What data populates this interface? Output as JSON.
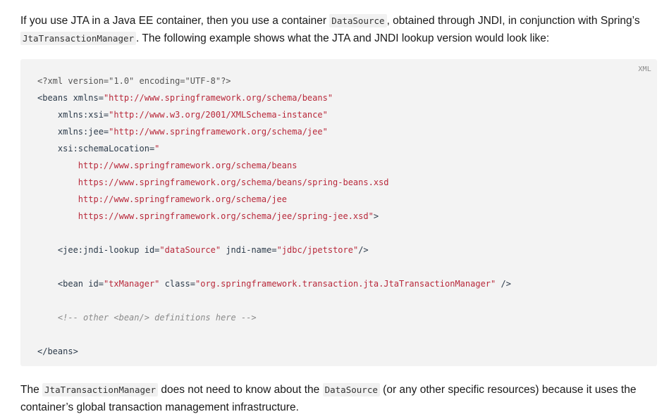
{
  "intro": {
    "t1": "If you use JTA in a Java EE container, then you use a container ",
    "c1": "DataSource",
    "t2": ", obtained through JNDI, in conjunction with Spring’s ",
    "c2": "JtaTransactionManager",
    "t3": ". The following example shows what the JTA and JNDI lookup version would look like:"
  },
  "code": {
    "language": "XML",
    "lines": {
      "l1_pi": "<?xml version=\"1.0\" encoding=\"UTF-8\"?>",
      "l2_tag": "<beans",
      "l2_attr": " xmlns=",
      "l2_val": "\"http://www.springframework.org/schema/beans\"",
      "l3_attr": "    xmlns:xsi=",
      "l3_val": "\"http://www.w3.org/2001/XMLSchema-instance\"",
      "l4_attr": "    xmlns:jee=",
      "l4_val": "\"http://www.springframework.org/schema/jee\"",
      "l5_attr": "    xsi:schemaLocation=",
      "l5_val": "\"",
      "l6_val": "        http://www.springframework.org/schema/beans",
      "l7_val": "        https://www.springframework.org/schema/beans/spring-beans.xsd",
      "l8_val": "        http://www.springframework.org/schema/jee",
      "l9_val": "        https://www.springframework.org/schema/jee/spring-jee.xsd\"",
      "l9_tag": ">",
      "l11_tag": "    <jee:jndi-lookup",
      "l11_attr1": " id=",
      "l11_val1": "\"dataSource\"",
      "l11_attr2": " jndi-name=",
      "l11_val2": "\"jdbc/jpetstore\"",
      "l11_end": "/>",
      "l13_tag": "    <bean",
      "l13_attr1": " id=",
      "l13_val1": "\"txManager\"",
      "l13_attr2": " class=",
      "l13_val2": "\"org.springframework.transaction.jta.JtaTransactionManager\"",
      "l13_end": " />",
      "l15_comment": "    <!-- other <bean/> definitions here -->",
      "l17_tag": "</beans>"
    }
  },
  "outro": {
    "t1": "The ",
    "c1": "JtaTransactionManager",
    "t2": " does not need to know about the ",
    "c2": "DataSource",
    "t3": " (or any other specific resources) because it uses the container’s global transaction management infrastructure."
  }
}
